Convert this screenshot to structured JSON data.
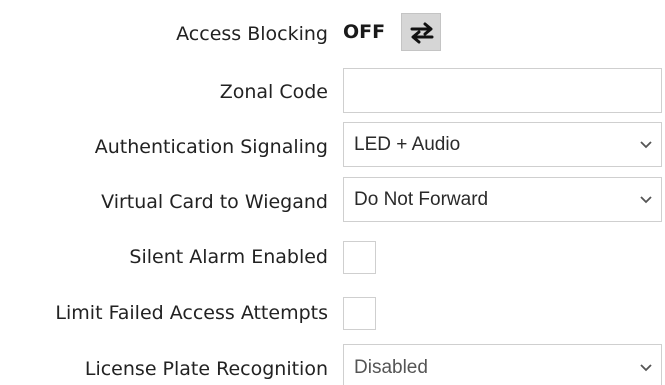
{
  "access_blocking": {
    "label": "Access Blocking",
    "status": "OFF",
    "toggle_icon": "swap-arrows-icon"
  },
  "zonal_code": {
    "label": "Zonal Code",
    "value": ""
  },
  "authentication_signaling": {
    "label": "Authentication Signaling",
    "value": "LED + Audio"
  },
  "virtual_card": {
    "label": "Virtual Card to Wiegand",
    "value": "Do Not Forward"
  },
  "silent_alarm": {
    "label": "Silent Alarm Enabled",
    "checked": false
  },
  "limit_failed": {
    "label": "Limit Failed Access Attempts",
    "checked": false
  },
  "license_plate": {
    "label": "License Plate Recognition",
    "value": "Disabled"
  }
}
